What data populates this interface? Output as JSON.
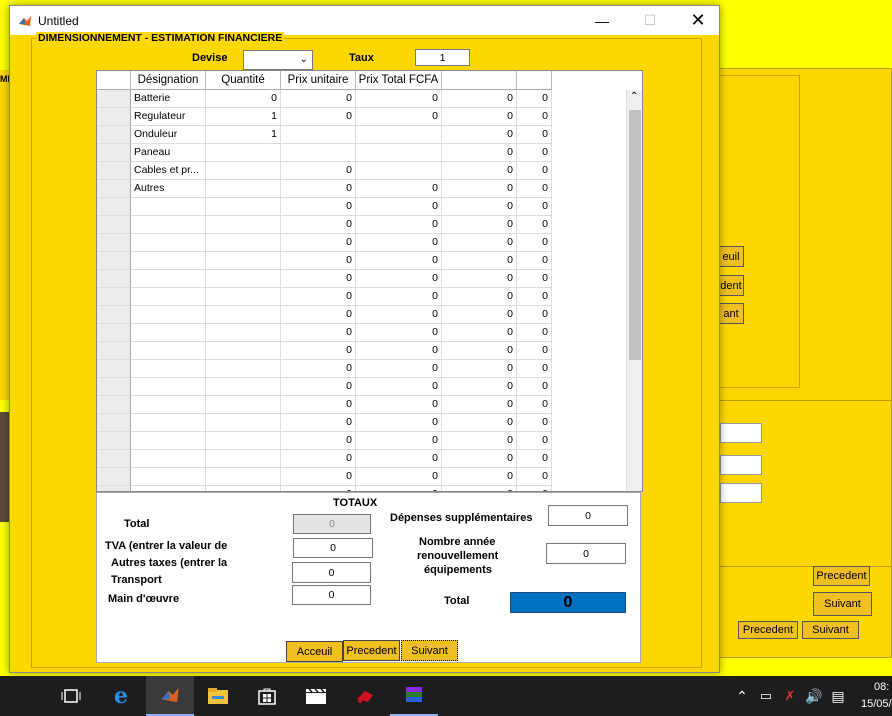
{
  "window": {
    "title": "Untitled",
    "minimize_icon": "minimize-icon",
    "maximize_icon": "maximize-icon",
    "close_icon": "close-icon"
  },
  "panel_title": "DIMENSIONNEMENT - ESTIMATION FINANCIERE",
  "devise": {
    "label": "Devise",
    "value": ""
  },
  "taux": {
    "label": "Taux",
    "value": "1"
  },
  "table": {
    "columns": [
      "Désignation",
      "Quantité",
      "Prix unitaire",
      "Prix Total FCFA",
      "",
      ""
    ],
    "rows": [
      [
        "Batterie",
        "0",
        "0",
        "0",
        "0",
        "0"
      ],
      [
        "Regulateur",
        "1",
        "0",
        "0",
        "0",
        "0"
      ],
      [
        "Onduleur",
        "1",
        "",
        "",
        "0",
        "0"
      ],
      [
        "Paneau",
        "",
        "",
        "",
        "0",
        "0"
      ],
      [
        "Cables et pr...",
        "",
        "0",
        "",
        "0",
        "0"
      ],
      [
        "Autres",
        "",
        "0",
        "0",
        "0",
        "0"
      ],
      [
        "",
        "",
        "0",
        "0",
        "0",
        "0"
      ],
      [
        "",
        "",
        "0",
        "0",
        "0",
        "0"
      ],
      [
        "",
        "",
        "0",
        "0",
        "0",
        "0"
      ],
      [
        "",
        "",
        "0",
        "0",
        "0",
        "0"
      ],
      [
        "",
        "",
        "0",
        "0",
        "0",
        "0"
      ],
      [
        "",
        "",
        "0",
        "0",
        "0",
        "0"
      ],
      [
        "",
        "",
        "0",
        "0",
        "0",
        "0"
      ],
      [
        "",
        "",
        "0",
        "0",
        "0",
        "0"
      ],
      [
        "",
        "",
        "0",
        "0",
        "0",
        "0"
      ],
      [
        "",
        "",
        "0",
        "0",
        "0",
        "0"
      ],
      [
        "",
        "",
        "0",
        "0",
        "0",
        "0"
      ],
      [
        "",
        "",
        "0",
        "0",
        "0",
        "0"
      ],
      [
        "",
        "",
        "0",
        "0",
        "0",
        "0"
      ],
      [
        "",
        "",
        "0",
        "0",
        "0",
        "0"
      ],
      [
        "",
        "",
        "0",
        "0",
        "0",
        "0"
      ],
      [
        "",
        "",
        "0",
        "0",
        "0",
        "0"
      ],
      [
        "",
        "",
        "0",
        "0",
        "0",
        "0"
      ]
    ]
  },
  "totaux": {
    "heading": "TOTAUX",
    "total_label": "Total",
    "total_value": "0",
    "tva_label": "TVA (entrer la valeur de",
    "tva_value": "0",
    "autres_label_1": "Autres taxes (entrer la",
    "autres_label_2": "Transport",
    "autres_value": "0",
    "main_label": "Main d'œuvre",
    "main_value": "0",
    "depenses_label": "Dépenses supplémentaires",
    "depenses_value": "0",
    "nombre_label_1": "Nombre année",
    "nombre_label_2": "renouvellement",
    "nombre_label_3": "équipements",
    "nombre_value": "0",
    "grand_total_label": "Total",
    "grand_total_value": "0"
  },
  "buttons": {
    "acceuil": "Acceuil",
    "precedent": "Precedent",
    "suivant": "Suivant"
  },
  "background": {
    "btn_accueil_partial": "euil",
    "btn_precedent_partial": "dent",
    "btn_suivant_partial": "ant",
    "btn_precedent": "Precedent",
    "btn_suivant": "Suivant",
    "btn_precedent2": "Precedent",
    "btn_suivant2": "Suivant",
    "left_partial": "MI"
  },
  "taskbar": {
    "icons": [
      "task-view-icon",
      "edge-icon",
      "matlab-icon",
      "file-explorer-icon",
      "store-icon",
      "media-icon",
      "app-icon",
      "winrar-icon"
    ],
    "clock_time": "08:",
    "clock_date": "15/05/"
  },
  "colors": {
    "yellow": "#ffff00",
    "gold": "#ffd700",
    "blue_total": "#0070c0",
    "button": "#f0c020"
  }
}
